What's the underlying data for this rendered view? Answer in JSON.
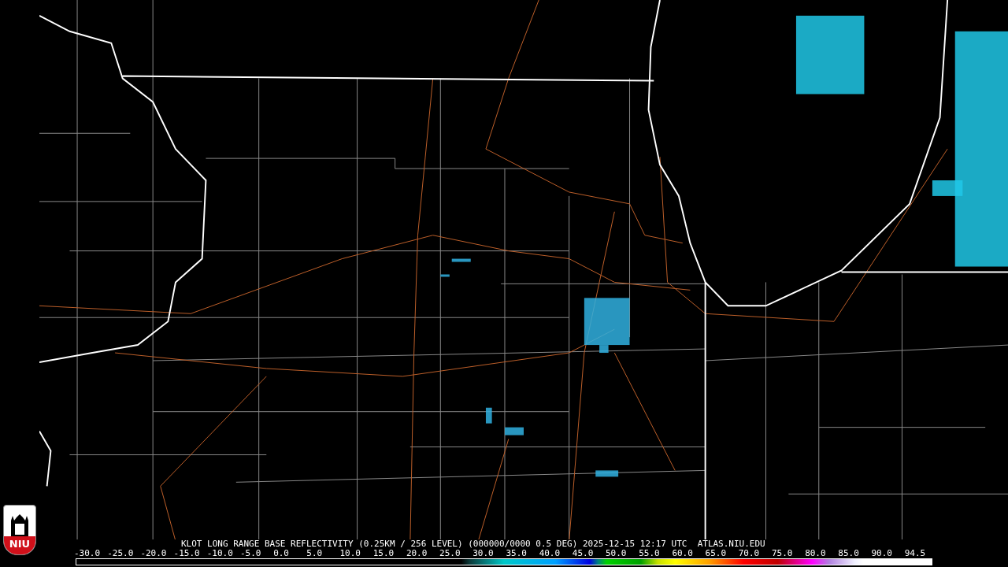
{
  "logo": {
    "text": "NIU"
  },
  "caption": "KLOT LONG RANGE BASE REFLECTIVITY (0.25KM / 256 LEVEL) (000000/0000 0.5 DEG) 2025-12-15 12:17 UTC  ATLAS.NIU.EDU",
  "scale": {
    "labels": [
      "-30.0",
      "-25.0",
      "-20.0",
      "-15.0",
      "-10.0",
      "-5.0",
      "0.0",
      "5.0",
      "10.0",
      "15.0",
      "20.0",
      "25.0",
      "30.0",
      "35.0",
      "40.0",
      "45.0",
      "50.0",
      "55.0",
      "60.0",
      "65.0",
      "70.0",
      "75.0",
      "80.0",
      "85.0",
      "90.0",
      "94.5"
    ]
  }
}
